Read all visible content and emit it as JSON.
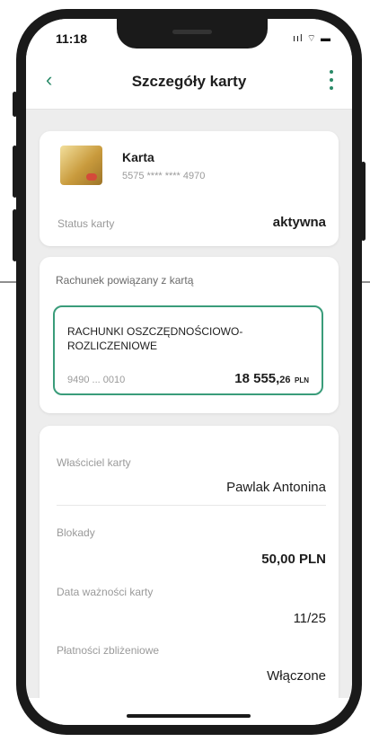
{
  "status_bar": {
    "time": "11:18",
    "icons_text": "ııl ⌔ ▬",
    "icons": [
      "signal-icon",
      "wifi-icon",
      "battery-icon"
    ]
  },
  "header": {
    "title": "Szczegóły karty",
    "back_icon": "‹",
    "accent_color": "#2a8a68"
  },
  "card_summary": {
    "name": "Karta",
    "number": "5575 **** **** 4970",
    "status_label": "Status karty",
    "status_value": "aktywna"
  },
  "linked_account": {
    "heading": "Rachunek powiązany z kartą",
    "name": "RACHUNKI OSZCZĘDNOŚCIOWO-ROZLICZENIOWE",
    "number": "9490 ... 0010",
    "balance_main": "18 555,",
    "balance_decimal": "26",
    "currency": "PLN",
    "border_color": "#3a9c7a"
  },
  "details": {
    "owner_label": "Właściciel karty",
    "owner_value": "Pawlak Antonina",
    "blocks_label": "Blokady",
    "blocks_value": "50,00 PLN",
    "expiry_label": "Data ważności karty",
    "expiry_value": "11/25",
    "contactless_label": "Płatności zbliżeniowe",
    "contactless_value": "Włączone"
  }
}
